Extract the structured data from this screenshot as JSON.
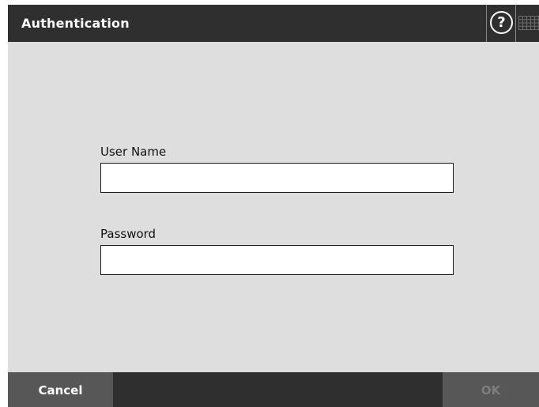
{
  "header": {
    "title": "Authentication",
    "help_icon": "help-icon",
    "help_glyph": "?",
    "keyboard_icon": "keyboard-icon"
  },
  "form": {
    "username": {
      "label": "User Name",
      "value": "",
      "placeholder": ""
    },
    "password": {
      "label": "Password",
      "value": "",
      "placeholder": ""
    }
  },
  "footer": {
    "cancel_label": "Cancel",
    "ok_label": "OK",
    "ok_enabled": false
  },
  "colors": {
    "header_bg": "#2f2f2f",
    "content_bg": "#dedede",
    "button_bg": "#575757",
    "disabled_text": "#7d7d7d"
  }
}
